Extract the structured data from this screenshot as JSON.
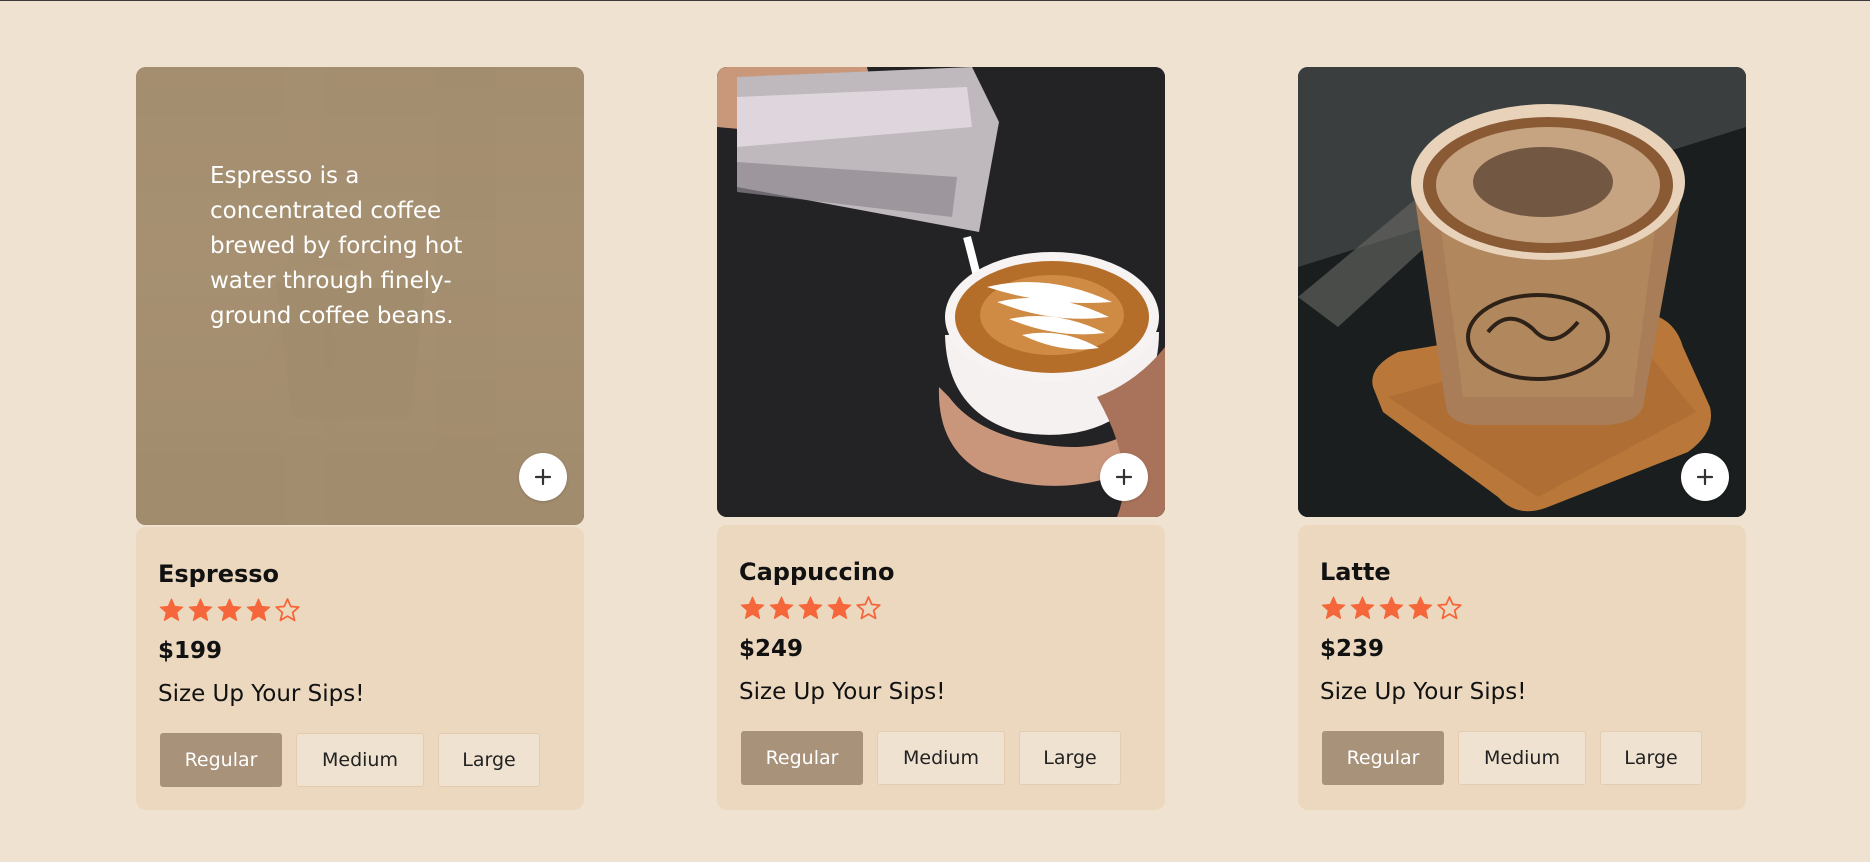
{
  "colors": {
    "background": "#efe2d1",
    "card_info_bg": "#ebd8bf",
    "overlay": "#a8927a",
    "selected_size_bg": "#a8927a",
    "star": "#f5673a"
  },
  "products": [
    {
      "name": "Espresso",
      "rating": 4,
      "rating_max": 5,
      "price": "$199",
      "size_title": "Size Up Your Sips!",
      "description": "Espresso is a concentrated coffee brewed by forcing hot water through finely-ground coffee beans.",
      "add_icon": "plus-icon",
      "sizes": [
        "Regular",
        "Medium",
        "Large"
      ],
      "selected_size": "Regular"
    },
    {
      "name": "Cappuccino",
      "rating": 4,
      "rating_max": 5,
      "price": "$249",
      "size_title": "Size Up Your Sips!",
      "add_icon": "plus-icon",
      "sizes": [
        "Regular",
        "Medium",
        "Large"
      ],
      "selected_size": "Regular"
    },
    {
      "name": "Latte",
      "rating": 4,
      "rating_max": 5,
      "price": "$239",
      "size_title": "Size Up Your Sips!",
      "add_icon": "plus-icon",
      "sizes": [
        "Regular",
        "Medium",
        "Large"
      ],
      "selected_size": "Regular"
    }
  ]
}
